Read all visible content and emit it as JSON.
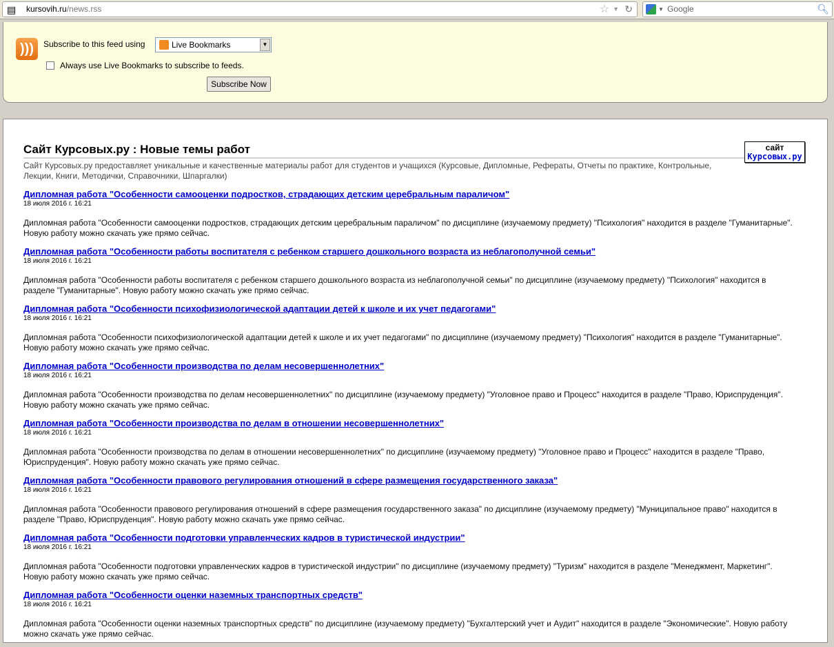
{
  "browser": {
    "url_domain": "kursovih.ru",
    "url_path": "/news.rss",
    "search_placeholder": "Google"
  },
  "subscribe": {
    "label": "Subscribe to this feed using",
    "reader": "Live Bookmarks",
    "always_label": "Always use Live Bookmarks to subscribe to feeds.",
    "button": "Subscribe Now"
  },
  "feed": {
    "title": "Сайт Курсовых.ру : Новые темы работ",
    "description": "Сайт Курсовых.ру предоставляет уникальные и качественные материалы работ для студентов и учащихся (Курсовые, Дипломные, Рефераты, Отчеты по практике, Контрольные, Лекции, Книги, Методички, Справочники, Шпаргалки)",
    "logo_top": "сайт",
    "logo_bottom": "Курсовых.ру"
  },
  "entries": [
    {
      "title": "Дипломная работа \"Особенности самооценки подростков, страдающих детским церебральным параличом\"",
      "date": "18 июля 2016 г. 16:21",
      "desc": "Дипломная работа \"Особенности самооценки подростков, страдающих детским церебральным параличом\" по дисциплине (изучаемому предмету) \"Психология\" находится в разделе \"Гуманитарные\". Новую работу можно скачать уже прямо сейчас."
    },
    {
      "title": "Дипломная работа \"Особенности работы воспитателя с ребенком старшего дошкольного возраста из неблагополучной семьи\"",
      "date": "18 июля 2016 г. 16:21",
      "desc": "Дипломная работа \"Особенности работы воспитателя с ребенком старшего дошкольного возраста из неблагополучной семьи\" по дисциплине (изучаемому предмету) \"Психология\" находится в разделе \"Гуманитарные\". Новую работу можно скачать уже прямо сейчас."
    },
    {
      "title": "Дипломная работа \"Особенности психофизиологической адаптации детей к школе и их учет педагогами\"",
      "date": "18 июля 2016 г. 16:21",
      "desc": "Дипломная работа \"Особенности психофизиологической адаптации детей к школе и их учет педагогами\" по дисциплине (изучаемому предмету) \"Психология\" находится в разделе \"Гуманитарные\". Новую работу можно скачать уже прямо сейчас."
    },
    {
      "title": "Дипломная работа \"Особенности производства по делам несовершеннолетних\"",
      "date": "18 июля 2016 г. 16:21",
      "desc": "Дипломная работа \"Особенности производства по делам несовершеннолетних\" по дисциплине (изучаемому предмету) \"Уголовное право и Процесс\" находится в разделе \"Право, Юриспруденция\". Новую работу можно скачать уже прямо сейчас."
    },
    {
      "title": "Дипломная работа \"Особенности производства по делам в отношении несовершеннолетних\"",
      "date": "18 июля 2016 г. 16:21",
      "desc": "Дипломная работа \"Особенности производства по делам в отношении несовершеннолетних\" по дисциплине (изучаемому предмету) \"Уголовное право и Процесс\" находится в разделе \"Право, Юриспруденция\". Новую работу можно скачать уже прямо сейчас."
    },
    {
      "title": "Дипломная работа \"Особенности правового регулирования отношений в сфере размещения государственного заказа\"",
      "date": "18 июля 2016 г. 16:21",
      "desc": "Дипломная работа \"Особенности правового регулирования отношений в сфере размещения государственного заказа\" по дисциплине (изучаемому предмету) \"Муниципальное право\" находится в разделе \"Право, Юриспруденция\". Новую работу можно скачать уже прямо сейчас."
    },
    {
      "title": "Дипломная работа \"Особенности подготовки управленческих кадров в туристической индустрии\"",
      "date": "18 июля 2016 г. 16:21",
      "desc": "Дипломная работа \"Особенности подготовки управленческих кадров в туристической индустрии\" по дисциплине (изучаемому предмету) \"Туризм\" находится в разделе \"Менеджмент, Маркетинг\". Новую работу можно скачать уже прямо сейчас."
    },
    {
      "title": "Дипломная работа \"Особенности оценки наземных транспортных средств\"",
      "date": "18 июля 2016 г. 16:21",
      "desc": "Дипломная работа \"Особенности оценки наземных транспортных средств\" по дисциплине (изучаемому предмету) \"Бухгалтерский учет и Аудит\" находится в разделе \"Экономические\". Новую работу можно скачать уже прямо сейчас."
    }
  ]
}
